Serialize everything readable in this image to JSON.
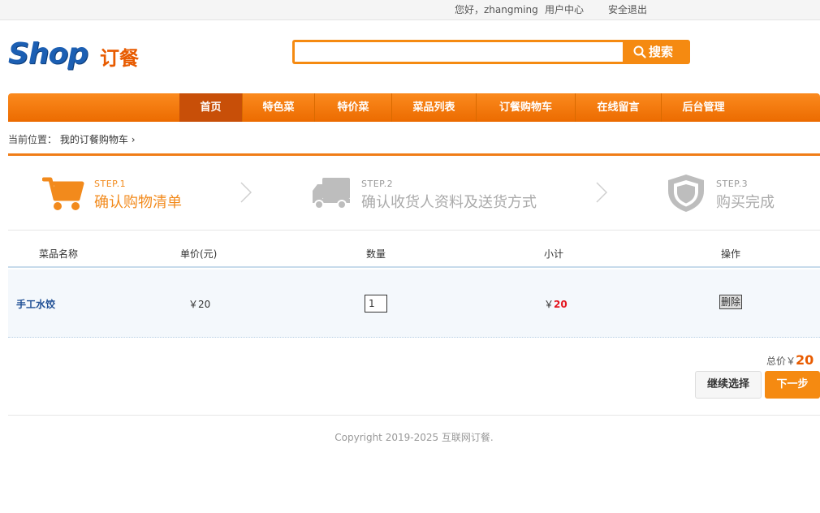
{
  "topbar": {
    "greeting": "您好，zhangming",
    "user_center": "用户中心",
    "logout": "安全退出"
  },
  "logo": {
    "brand": "Shop",
    "suffix": "订餐"
  },
  "search": {
    "value": "",
    "button_label": "搜索"
  },
  "nav": {
    "items": [
      "首页",
      "特色菜",
      "特价菜",
      "菜品列表",
      "订餐购物车",
      "在线留言",
      "后台管理"
    ],
    "active_index": 0
  },
  "breadcrumb": {
    "label": "当前位置：",
    "path": "我的订餐购物车",
    "separator": "›"
  },
  "steps": [
    {
      "num": "STEP.1",
      "title": "确认购物清单",
      "active": true,
      "icon": "cart-icon"
    },
    {
      "num": "STEP.2",
      "title": "确认收货人资料及送货方式",
      "active": false,
      "icon": "truck-icon"
    },
    {
      "num": "STEP.3",
      "title": "购买完成",
      "active": false,
      "icon": "shield-icon"
    }
  ],
  "table": {
    "headers": [
      "菜品名称",
      "单价(元)",
      "数量",
      "小计",
      "操作"
    ],
    "rows": [
      {
        "name": "手工水饺",
        "price": "￥20",
        "qty": "1",
        "subtotal_prefix": "￥",
        "subtotal": "20",
        "action": "删除"
      }
    ]
  },
  "summary": {
    "total_label": "总价￥",
    "total_value": "20",
    "continue_label": "继续选择",
    "next_label": "下一步"
  },
  "footer": {
    "copyright": "Copyright 2019-2025 互联网订餐."
  },
  "colors": {
    "accent": "#f58a11",
    "nav_active": "#c84f08",
    "link": "#1f4f95",
    "price_red": "#e4161f"
  }
}
